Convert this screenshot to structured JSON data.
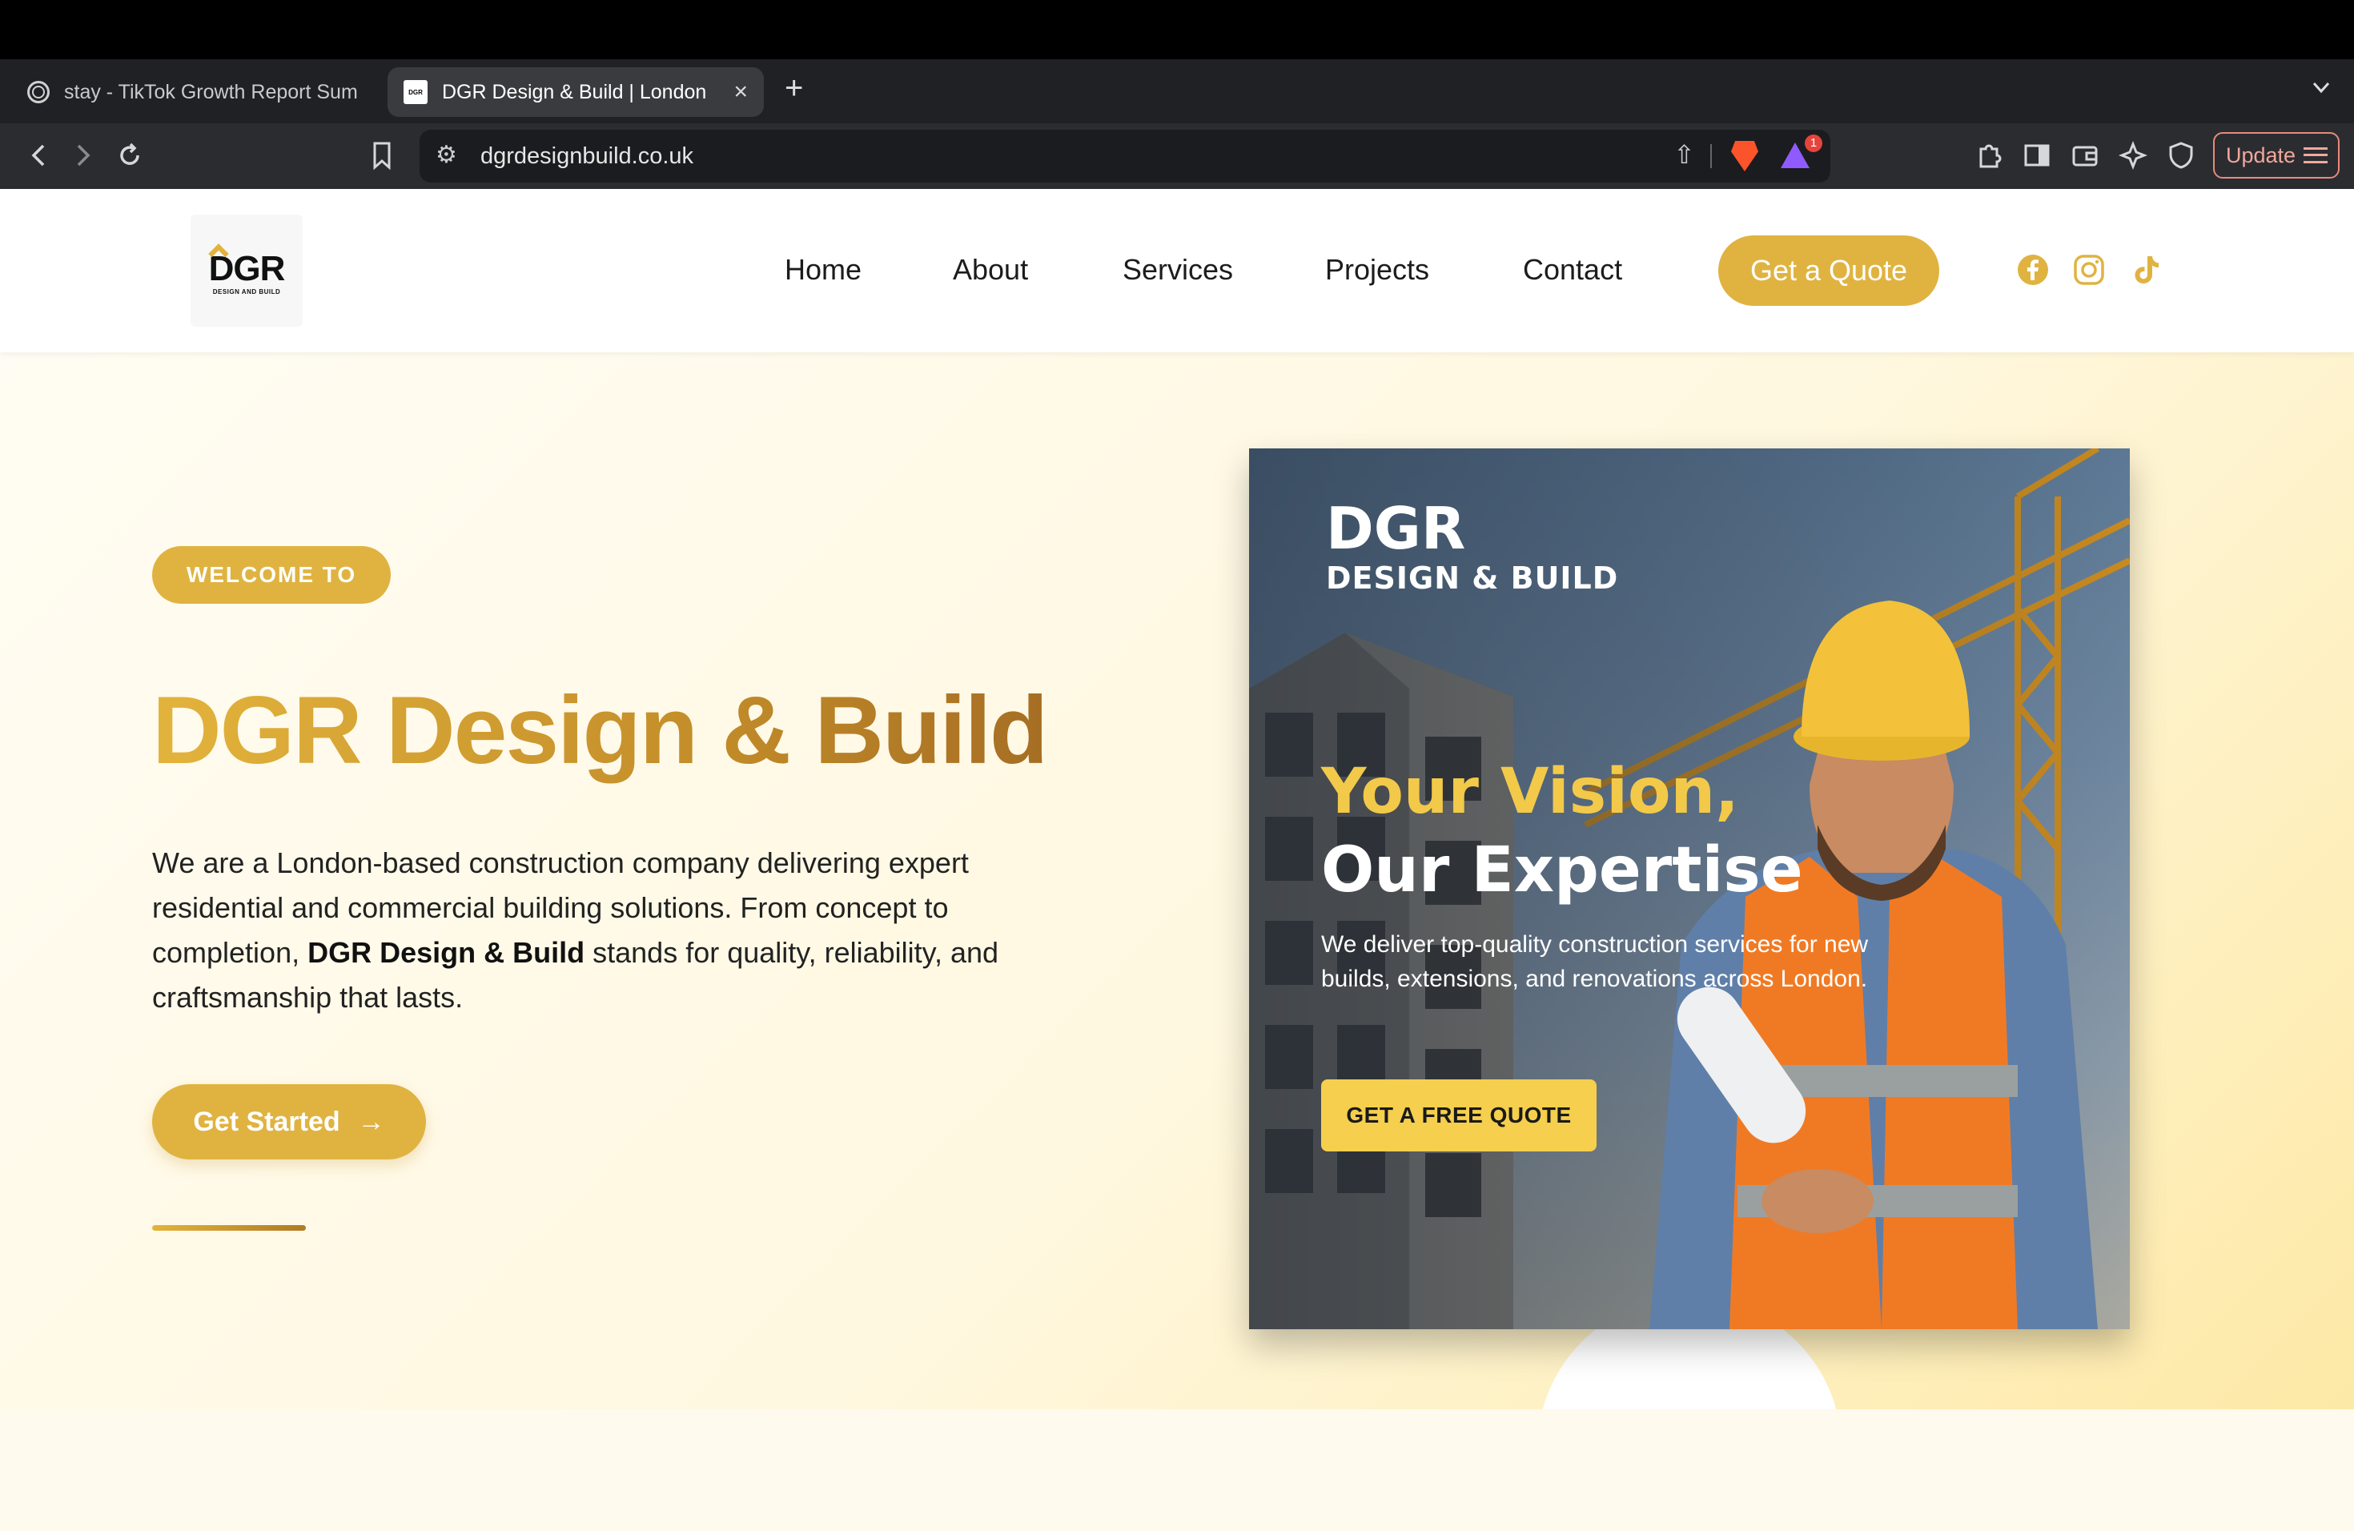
{
  "browser": {
    "tabs": [
      {
        "title": "stay - TikTok Growth Report Sum",
        "active": false
      },
      {
        "title": "DGR Design & Build | London",
        "active": true
      }
    ],
    "url": "dgrdesignbuild.co.uk",
    "update_label": "Update",
    "shields_badge": "1"
  },
  "site": {
    "logo": {
      "mark": "DGR",
      "sub": "DESIGN AND BUILD"
    },
    "nav": [
      "Home",
      "About",
      "Services",
      "Projects",
      "Contact"
    ],
    "quote_button": "Get a Quote",
    "social_icons": [
      "facebook-icon",
      "instagram-icon",
      "tiktok-icon"
    ],
    "accent_color": "#e0b341"
  },
  "hero": {
    "badge": "WELCOME TO",
    "title": "DGR Design & Build",
    "text_before": "We are a London-based construction company delivering expert residential and commercial building solutions. From concept to completion, ",
    "text_bold": "DGR Design & Build",
    "text_after": " stands for quality, reliability, and craftsmanship that lasts.",
    "cta": "Get Started",
    "cta_arrow": "→"
  },
  "card": {
    "brand_big": "DGR",
    "brand_small": "DESIGN & BUILD",
    "headline_1": "Your Vision,",
    "headline_2": "Our Expertise",
    "description": "We deliver top-quality construction services for new builds, extensions, and renovations across London.",
    "cta": "GET A FREE QUOTE"
  }
}
